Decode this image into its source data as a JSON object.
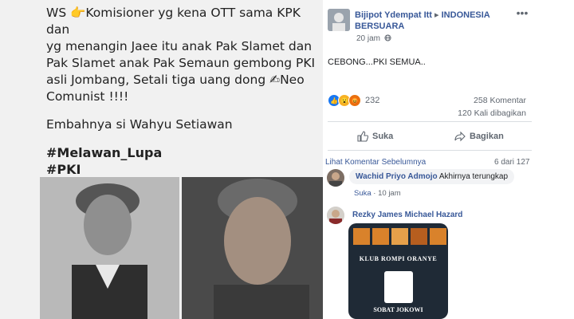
{
  "post_image": {
    "caption_lines": [
      "WS 👉Komisioner yg kena OTT sama KPK dan",
      "yg menangin Jaee  itu anak Pak Slamet dan",
      "Pak Slamet anak Pak Semaun gembong PKI",
      "asli Jombang, Setali tiga uang dong  ✍Neo",
      "Comunist !!!!"
    ],
    "caption_line2": "Embahnya si Wahyu Setiawan",
    "hashtags": [
      "#Melawan_Lupa",
      "#PKI"
    ]
  },
  "post": {
    "page_name": "Bijipot Ydempat Itt",
    "arrow": "▸",
    "group_name": "INDONESIA BERSUARA",
    "time": "20 jam",
    "globe_icon": "globe-icon",
    "text": "CEBONG...PKI SEMUA..",
    "reaction_count": "232",
    "comments_count": "258 Komentar",
    "shares_count": "120 Kali dibagikan",
    "like_label": "Suka",
    "share_label": "Bagikan"
  },
  "comments": {
    "view_previous": "Lihat Komentar Sebelumnya",
    "position": "6 dari 127",
    "items": [
      {
        "author": "Wachid Priyo Admojo",
        "text": "Akhirnya terungkap",
        "like_label": "Suka",
        "time": "10 jam"
      },
      {
        "author": "Rezky James Michael Hazard",
        "image_title": "KLUB ROMPI ORANYE",
        "image_bottom": "SOBAT JOKOWI"
      }
    ]
  },
  "colors": {
    "link": "#385898",
    "secondary_text": "#606770",
    "like_reaction": "#1877f2",
    "wow_reaction": "#f7b125",
    "angry_reaction": "#e9710f"
  }
}
